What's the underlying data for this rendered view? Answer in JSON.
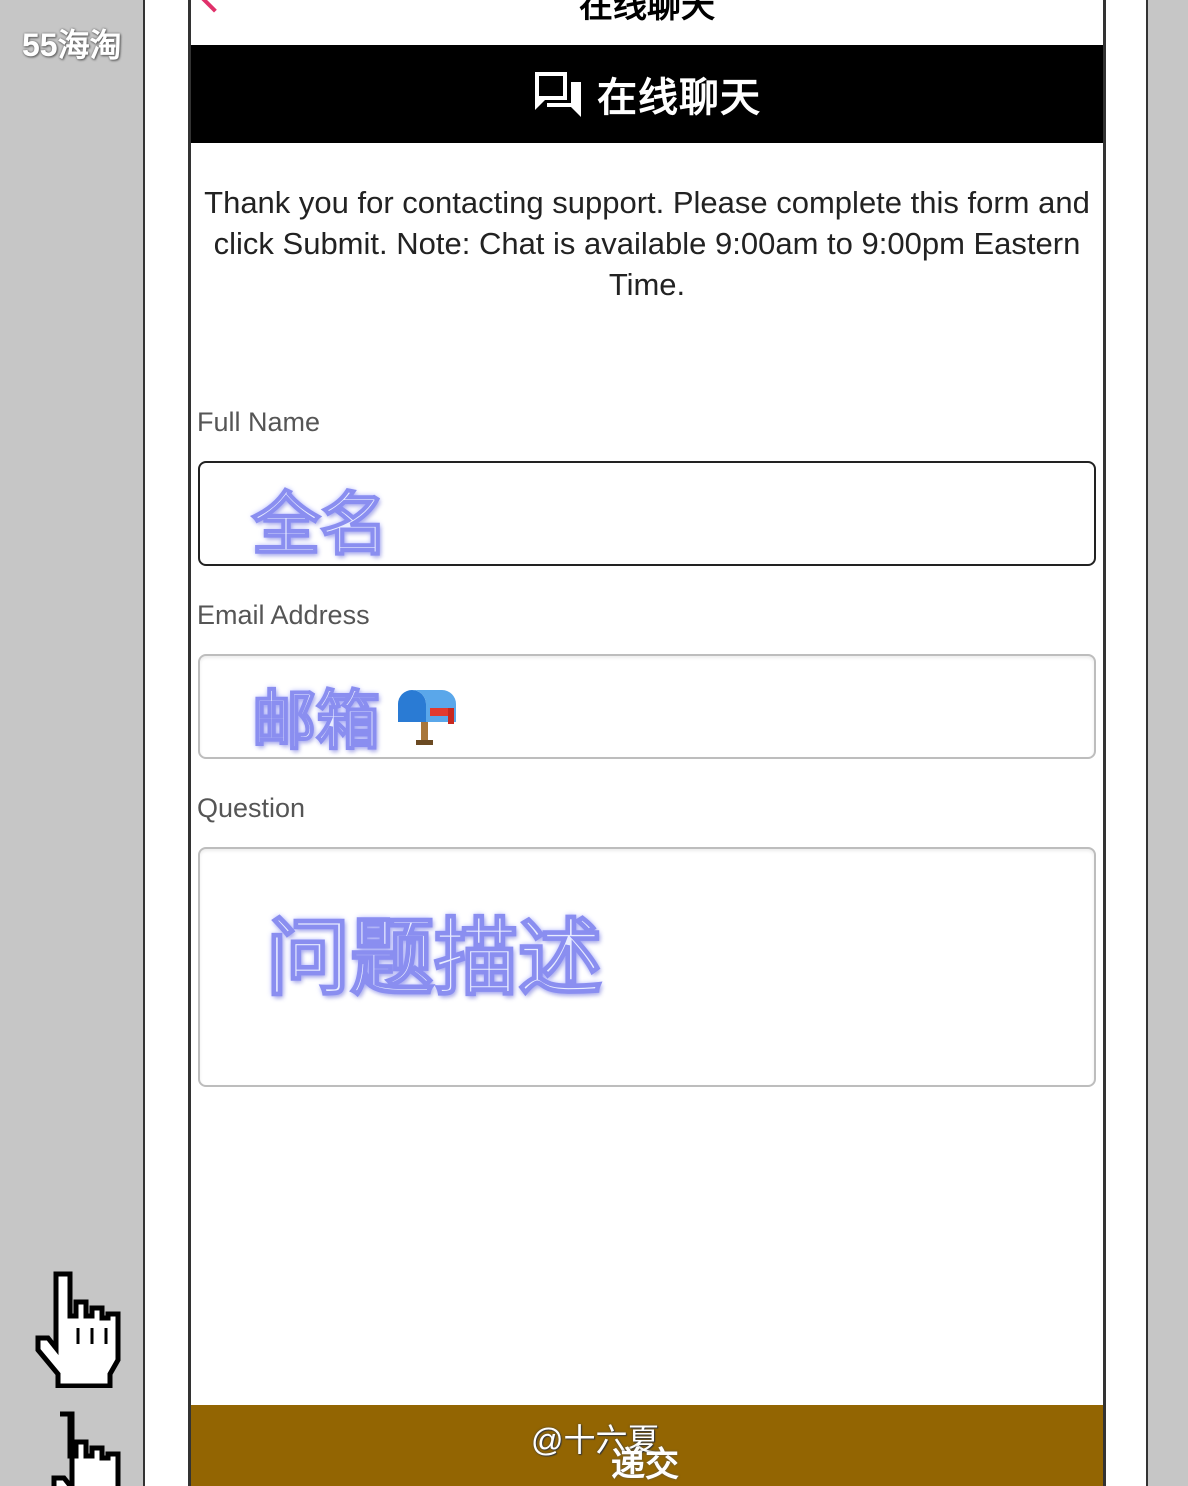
{
  "watermark": "55海淘",
  "topbar": {
    "title": "在线聊天"
  },
  "header": {
    "title": "在线聊天",
    "icon": "chat-bubbles-icon"
  },
  "intro": "Thank you for contacting support. Please complete this form and click Submit. Note: Chat is available 9:00am to 9:00pm Eastern Time.",
  "form": {
    "full_name": {
      "label": "Full Name",
      "annotation": "全名"
    },
    "email": {
      "label": "Email Address",
      "annotation": "邮箱",
      "icon": "mailbox-icon"
    },
    "question": {
      "label": "Question",
      "annotation": "问题描述"
    }
  },
  "submit": {
    "label": "递交",
    "credit": "@十六夏"
  },
  "colors": {
    "header_bg": "#000000",
    "submit_bg": "#936502",
    "back_accent": "#e0306a",
    "annotation": "#8a8ef0"
  }
}
